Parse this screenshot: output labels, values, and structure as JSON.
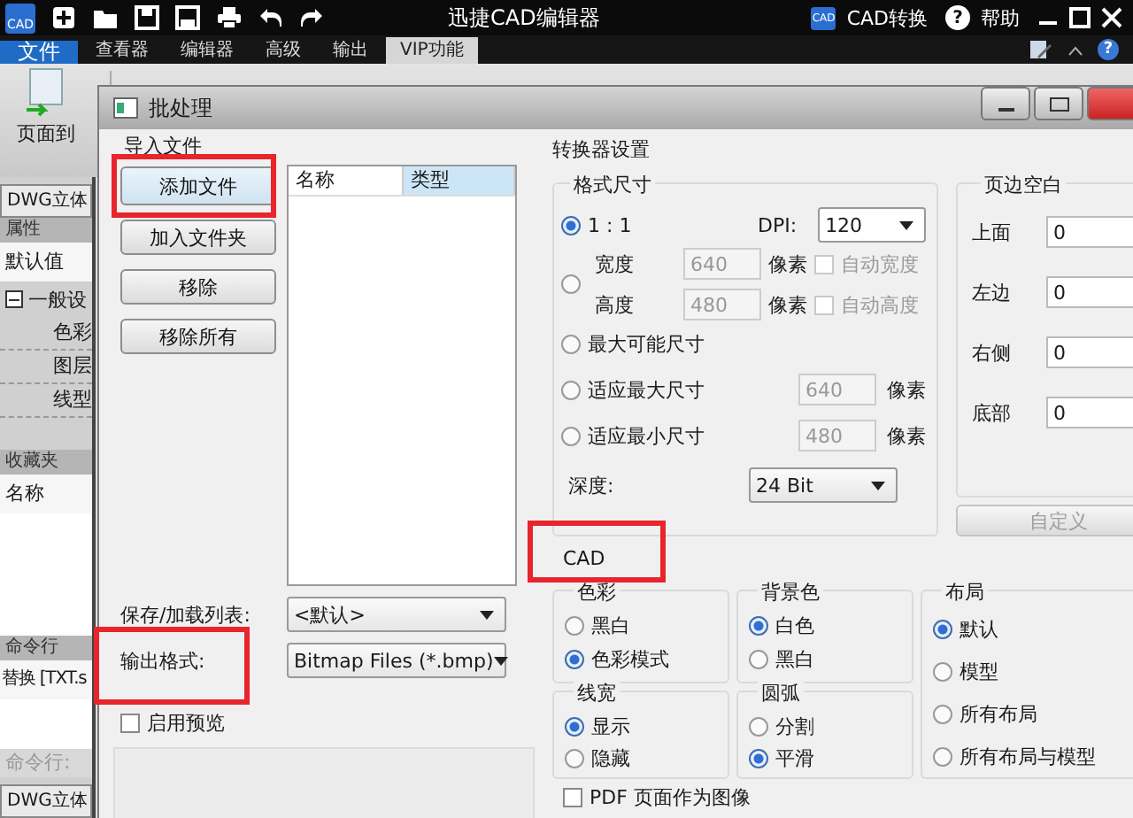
{
  "app": {
    "logo_text": "CAD",
    "title": "迅捷CAD编辑器",
    "convert_icon_text": "CAD",
    "convert_label": "CAD转换",
    "help_glyph": "?",
    "help_label": "帮助",
    "ribbon_help_glyph": "?"
  },
  "menu_tabs": [
    {
      "label": "文件",
      "kind": "file",
      "selected": false
    },
    {
      "label": "查看器",
      "kind": "tab",
      "selected": false
    },
    {
      "label": "编辑器",
      "kind": "tab",
      "selected": false
    },
    {
      "label": "高级",
      "kind": "tab",
      "selected": false
    },
    {
      "label": "输出",
      "kind": "tab",
      "selected": false
    },
    {
      "label": "VIP功能",
      "kind": "tab",
      "selected": true
    }
  ],
  "ribbon": {
    "page_button": "页面到"
  },
  "left_panel": {
    "tab": "DWG立体",
    "properties_header": "属性",
    "default_value": "默认值",
    "tree": [
      {
        "label": "一般设",
        "expanded": true,
        "children": [
          {
            "label": "色彩"
          },
          {
            "label": "图层"
          },
          {
            "label": "线型"
          }
        ]
      }
    ],
    "favorites_header": "收藏夹",
    "favorites_column": "名称",
    "command_header": "命令行",
    "command_output": "替换 [TXT.s",
    "command_prompt": "命令行:",
    "bottom_tab": "DWG立体"
  },
  "dialog": {
    "title": "批处理",
    "import_group": "导入文件",
    "buttons": [
      "添加文件",
      "加入文件夹",
      "移除",
      "移除所有"
    ],
    "file_list": {
      "columns": [
        "名称",
        "类型"
      ]
    },
    "list_label": "保存/加载列表:",
    "list_value": "<默认>",
    "format_label": "输出格式:",
    "format_value": "Bitmap Files (*.bmp)",
    "preview": {
      "label": "启用预览",
      "checked": false
    },
    "converter": {
      "title": "转换器设置",
      "size_title": "格式尺寸",
      "size_options": [
        {
          "kind": "dpi",
          "label": "1 : 1",
          "selected": true,
          "dpi_label": "DPI:",
          "dpi_value": "120"
        },
        {
          "kind": "custom",
          "selected": false,
          "width_label": "宽度",
          "width_value": "640",
          "width_unit": "像素",
          "auto_width": {
            "label": "自动宽度",
            "checked": false
          },
          "height_label": "高度",
          "height_value": "480",
          "height_unit": "像素",
          "auto_height": {
            "label": "自动高度",
            "checked": false
          }
        },
        {
          "kind": "plain",
          "label": "最大可能尺寸",
          "selected": false
        },
        {
          "kind": "fit",
          "label": "适应最大尺寸",
          "selected": false,
          "value": "640",
          "unit": "像素"
        },
        {
          "kind": "fit",
          "label": "适应最小尺寸",
          "selected": false,
          "value": "480",
          "unit": "像素"
        }
      ],
      "depth_label": "深度:",
      "depth_value": "24 Bit",
      "margins_title": "页边空白",
      "margins": [
        {
          "label": "上面",
          "value": "0"
        },
        {
          "label": "左边",
          "value": "0"
        },
        {
          "label": "右侧",
          "value": "0"
        },
        {
          "label": "底部",
          "value": "0"
        }
      ],
      "custom_button": {
        "label": "自定义",
        "disabled": true
      }
    },
    "cad": {
      "title": "CAD",
      "groups": [
        {
          "title": "色彩",
          "options": [
            {
              "label": "黑白",
              "selected": false
            },
            {
              "label": "色彩模式",
              "selected": true
            }
          ]
        },
        {
          "title": "背景色",
          "options": [
            {
              "label": "白色",
              "selected": true
            },
            {
              "label": "黑白",
              "selected": false
            }
          ]
        },
        {
          "title": "线宽",
          "options": [
            {
              "label": "显示",
              "selected": true
            },
            {
              "label": "隐藏",
              "selected": false
            }
          ]
        },
        {
          "title": "圆弧",
          "options": [
            {
              "label": "分割",
              "selected": false
            },
            {
              "label": "平滑",
              "selected": true
            }
          ]
        }
      ],
      "layout_title": "布局",
      "layout_options": [
        {
          "label": "默认",
          "selected": true
        },
        {
          "label": "模型",
          "selected": false
        },
        {
          "label": "所有布局",
          "selected": false
        },
        {
          "label": "所有布局与模型",
          "selected": false
        }
      ],
      "pdf_image": {
        "label": "PDF 页面作为图像",
        "checked": false
      }
    }
  }
}
